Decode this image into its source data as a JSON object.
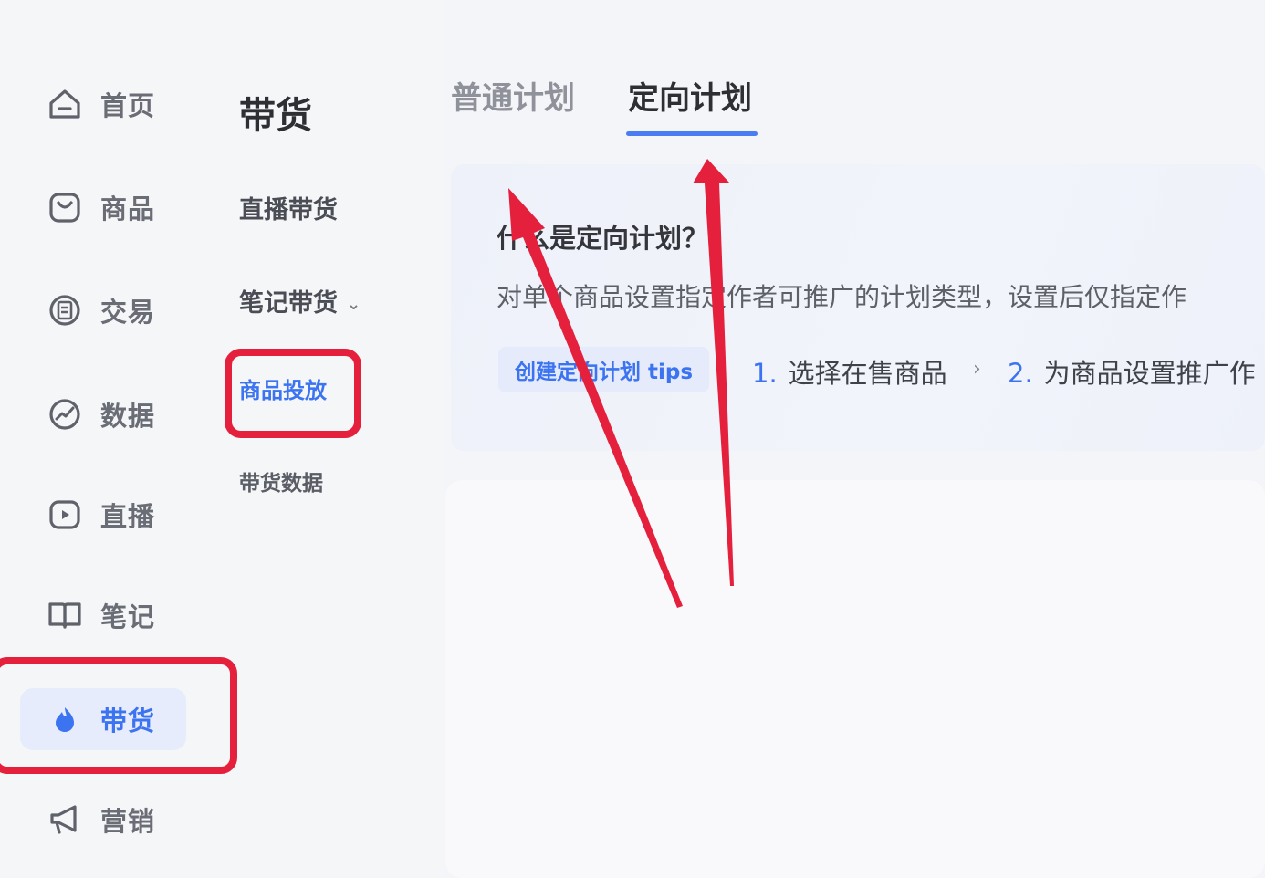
{
  "primary_nav": [
    {
      "label": "首页",
      "icon": "home-icon"
    },
    {
      "label": "商品",
      "icon": "shopping-bag-icon"
    },
    {
      "label": "交易",
      "icon": "receipt-icon"
    },
    {
      "label": "数据",
      "icon": "chart-icon"
    },
    {
      "label": "直播",
      "icon": "live-play-icon"
    },
    {
      "label": "笔记",
      "icon": "book-icon"
    },
    {
      "label": "带货",
      "icon": "fire-icon",
      "active": true
    },
    {
      "label": "营销",
      "icon": "megaphone-icon"
    }
  ],
  "secondary_nav": {
    "title": "带货",
    "items": [
      {
        "label": "直播带货"
      },
      {
        "label": "笔记带货"
      },
      {
        "label": "商品投放"
      },
      {
        "label": "带货数据"
      }
    ]
  },
  "tabs": [
    {
      "label": "普通计划"
    },
    {
      "label": "定向计划",
      "active": true
    }
  ],
  "info": {
    "title": "什么是定向计划？",
    "description": "对单个商品设置指定作者可推广的计划类型，设置后仅指定作",
    "tips_label": "创建定向计划 tips",
    "steps": [
      {
        "num": "1.",
        "text": "选择在售商品"
      },
      {
        "num": "2.",
        "text": "为商品设置推广作"
      }
    ]
  },
  "colors": {
    "accent": "#3b73f0",
    "annotation": "#e4203c"
  }
}
